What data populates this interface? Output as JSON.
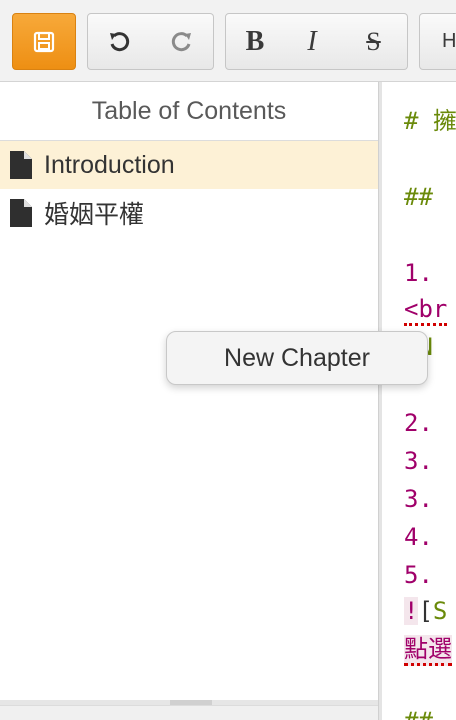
{
  "toolbar": {
    "bold_label": "B",
    "italic_label": "I",
    "strike_label": "S",
    "heading_label": "H",
    "accent_color": "#f39c1f"
  },
  "sidebar": {
    "title": "Table of Contents",
    "items": [
      {
        "label": "Introduction",
        "active": true
      },
      {
        "label": "婚姻平權",
        "active": false
      }
    ]
  },
  "context_menu": {
    "items": [
      {
        "label": "New Chapter"
      }
    ]
  },
  "editor": {
    "lines": {
      "l1": "# 擁",
      "l2": "##",
      "l3": "1.",
      "l4": "<br",
      "l5_bracket": "[",
      "l5_text": "N",
      "l6": "2.",
      "l7": "3.",
      "l8": "3.",
      "l9": "4.",
      "l10": "5.",
      "l11_bang": "!",
      "l11_bracket": "[",
      "l11_text": "S",
      "l12": "點選",
      "l13": "##"
    }
  }
}
